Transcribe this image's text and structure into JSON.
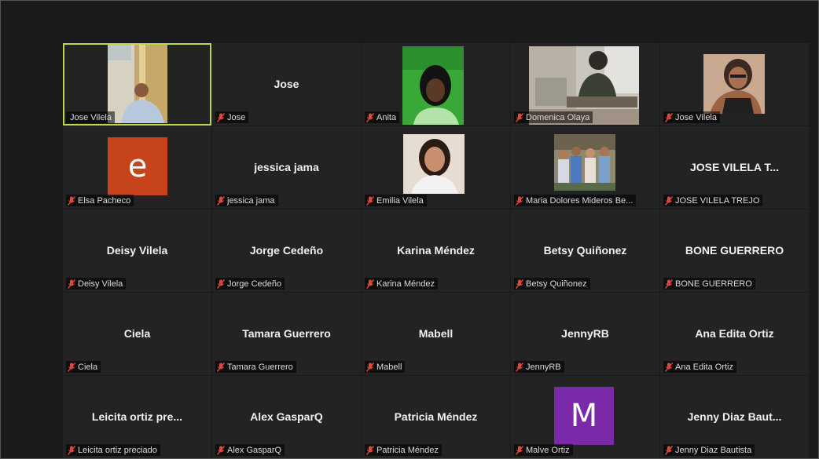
{
  "meeting": {
    "tiles": [
      {
        "label": "Jose Vilela"
      },
      {
        "display_name": "Jose",
        "label": "Jose"
      },
      {
        "label": "Anita"
      },
      {
        "label": "Domenica Olaya"
      },
      {
        "label": "Jose Vilela"
      },
      {
        "avatar_letter": "e",
        "label": "Elsa Pacheco"
      },
      {
        "display_name": "jessica jama",
        "label": "jessica jama"
      },
      {
        "label": "Emilia Vilela"
      },
      {
        "label": "Maria Dolores Mideros Be..."
      },
      {
        "display_name": "JOSE   VILELA   T...",
        "label": "JOSE   VILELA   TREJO"
      },
      {
        "display_name": "Deisy Vilela",
        "label": "Deisy Vilela"
      },
      {
        "display_name": "Jorge Cedeño",
        "label": "Jorge Cedeño"
      },
      {
        "display_name": "Karina Méndez",
        "label": "Karina Méndez"
      },
      {
        "display_name": "Betsy Quiñonez",
        "label": "Betsy Quiñonez"
      },
      {
        "display_name": "BONE GUERRERO",
        "label": "BONE GUERRERO"
      },
      {
        "display_name": "Ciela",
        "label": "Ciela"
      },
      {
        "display_name": "Tamara Guerrero",
        "label": "Tamara Guerrero"
      },
      {
        "display_name": "Mabell",
        "label": "Mabell"
      },
      {
        "display_name": "JennyRB",
        "label": "JennyRB"
      },
      {
        "display_name": "Ana Edita Ortiz",
        "label": "Ana Edita Ortiz"
      },
      {
        "display_name": "Leicita  ortiz  pre...",
        "label": "Leicita ortiz preciado"
      },
      {
        "display_name": "Alex GasparQ",
        "label": "Alex GasparQ"
      },
      {
        "display_name": "Patricia Méndez",
        "label": "Patricia Méndez"
      },
      {
        "avatar_letter": "M",
        "label": "Malve Ortiz"
      },
      {
        "display_name": "Jenny Diaz Baut...",
        "label": "Jenny Diaz Bautista"
      }
    ]
  },
  "colors": {
    "active_speaker_border": "#b9d84a",
    "muted_mic": "#e0463a",
    "avatar_e": "#c6431b",
    "avatar_m": "#7a2aa8"
  }
}
